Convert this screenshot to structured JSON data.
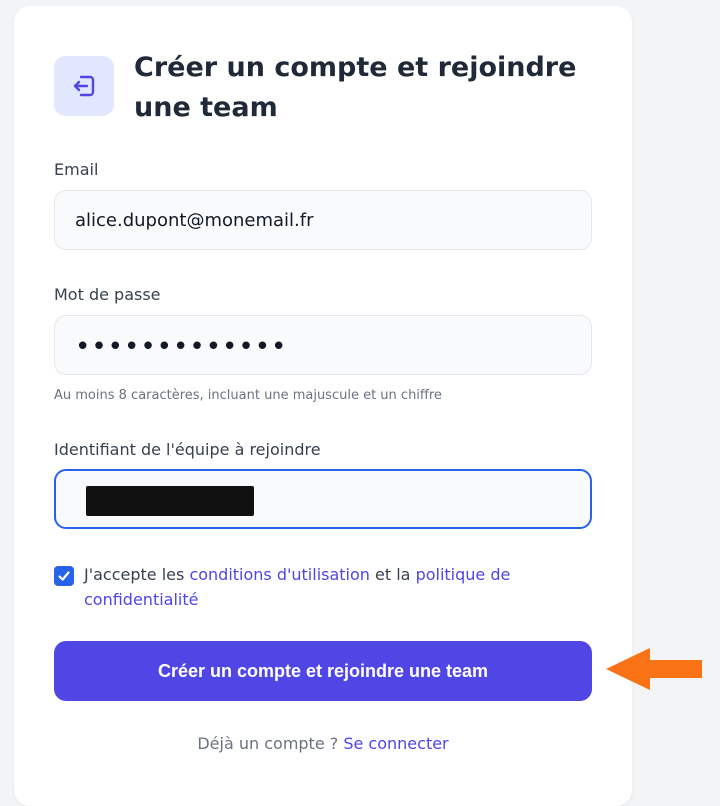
{
  "form": {
    "title": "Créer un compte et rejoindre une team",
    "email_label": "Email",
    "email_value": "alice.dupont@monemail.fr",
    "password_label": "Mot de passe",
    "password_value": "•••••••••••••",
    "password_hint": "Au moins 8 caractères, incluant une majuscule et un chiffre",
    "team_label": "Identifiant de l'équipe à rejoindre",
    "team_value": "[redacted]",
    "terms_checked": true,
    "terms_prefix": "J'accepte les ",
    "terms_link1": "conditions d'utilisation",
    "terms_middle": " et la ",
    "terms_link2": "politique de confidentialité",
    "submit_label": "Créer un compte et rejoindre une team",
    "login_prompt": "Déjà un compte ?",
    "login_link": "Se connecter"
  },
  "colors": {
    "accent": "#5046e5",
    "link": "#4f46e5",
    "focus": "#2563eb",
    "annotation_arrow": "#f97316"
  },
  "icons": {
    "logo": "login-enter-icon",
    "checkbox": "check-icon",
    "annotation": "arrow-left-icon"
  }
}
